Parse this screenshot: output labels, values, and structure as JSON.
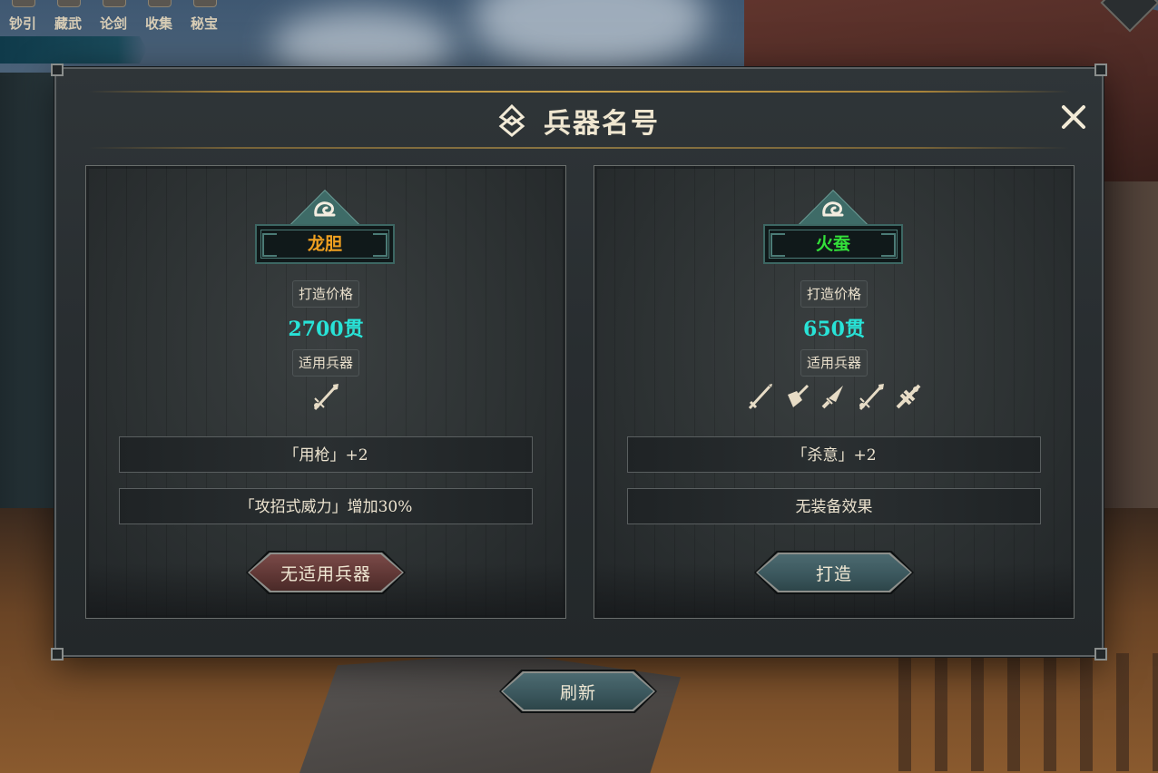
{
  "topnav": {
    "items": [
      {
        "label": "钞引"
      },
      {
        "label": "藏武"
      },
      {
        "label": "论剑"
      },
      {
        "label": "收集"
      },
      {
        "label": "秘宝"
      }
    ]
  },
  "modal": {
    "title": "兵器名号",
    "close_icon": "close-x-icon",
    "cards": [
      {
        "name": "龙胆",
        "name_color": "#f0a020",
        "price_label": "打造价格",
        "price": "2700贯",
        "weapons_label": "适用兵器",
        "weapons": [
          "spear-icon"
        ],
        "effects": [
          "「用枪」+2",
          "「攻招式威力」增加30%"
        ],
        "button_label": "无适用兵器",
        "button_style": "red"
      },
      {
        "name": "火蚕",
        "name_color": "#33e03a",
        "price_label": "打造价格",
        "price": "650贯",
        "weapons_label": "适用兵器",
        "weapons": [
          "sword-icon",
          "blade-icon",
          "dagger-icon",
          "spear-icon",
          "staff-icon"
        ],
        "effects": [
          "「杀意」+2",
          "无装备效果"
        ],
        "button_label": "打造",
        "button_style": "teal"
      }
    ]
  },
  "refresh_label": "刷新",
  "colors": {
    "price": "#28e3d7",
    "gold_line": "#c9a24b",
    "text": "#ece3cf"
  }
}
